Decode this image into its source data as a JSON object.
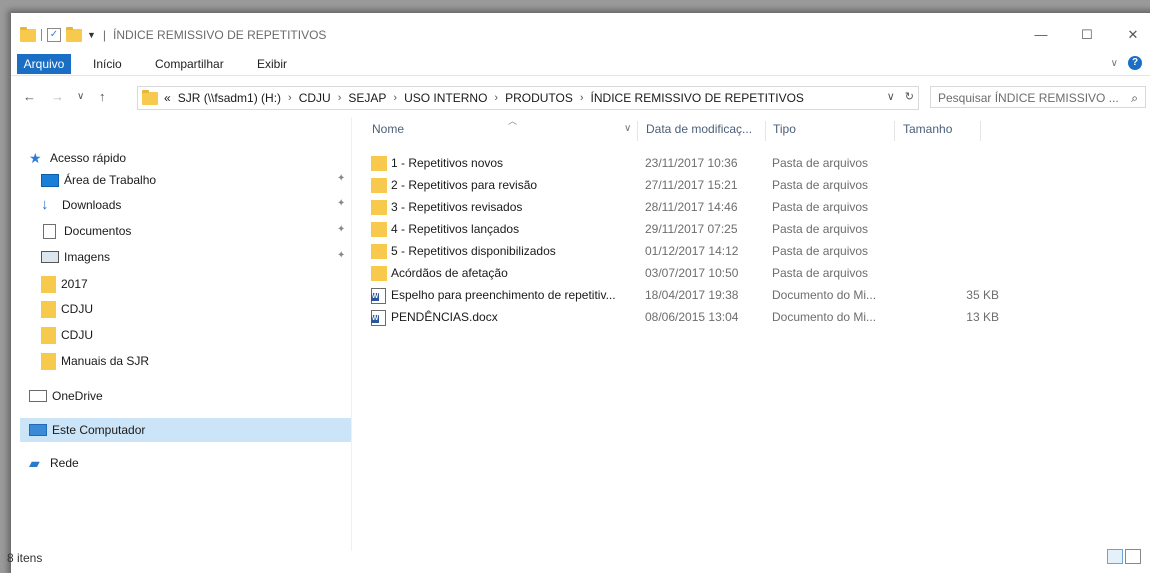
{
  "window": {
    "title": "ÍNDICE REMISSIVO DE REPETITIVOS",
    "title_sep": "|"
  },
  "window_controls": {
    "minimize": "—",
    "maximize": "☐",
    "close": "✕"
  },
  "ribbon": {
    "tabs": [
      "Arquivo",
      "Início",
      "Compartilhar",
      "Exibir"
    ],
    "expand": "∨",
    "help": "?"
  },
  "address": {
    "back": "←",
    "forward": "→",
    "recent": "∨",
    "up": "↑",
    "prefix": "«",
    "crumbs": [
      "SJR (\\\\fsadm1) (H:)",
      "CDJU",
      "SEJAP",
      "USO INTERNO",
      "PRODUTOS",
      "ÍNDICE REMISSIVO DE REPETITIVOS"
    ],
    "sep": "›",
    "dropdown": "∨",
    "refresh": "↻"
  },
  "search": {
    "placeholder": "Pesquisar ÍNDICE REMISSIVO ...",
    "icon": "⌕"
  },
  "nav": {
    "quick_access": "Acesso rápido",
    "pinned": [
      "Área de Trabalho",
      "Downloads",
      "Documentos",
      "Imagens"
    ],
    "folders": [
      "2017",
      "CDJU",
      "CDJU",
      "Manuais da SJR"
    ],
    "onedrive": "OneDrive",
    "this_pc": "Este Computador",
    "network": "Rede",
    "pin_glyph": "✦"
  },
  "columns": {
    "name": "Nome",
    "date": "Data de modificaç...",
    "type": "Tipo",
    "size": "Tamanho",
    "sort_glyph": "︿",
    "dd_glyph": "∨"
  },
  "files": [
    {
      "name": "1 - Repetitivos novos",
      "date": "23/11/2017 10:36",
      "type": "Pasta de arquivos",
      "size": "",
      "icon": "folder"
    },
    {
      "name": "2 - Repetitivos para revisão",
      "date": "27/11/2017 15:21",
      "type": "Pasta de arquivos",
      "size": "",
      "icon": "folder"
    },
    {
      "name": "3 - Repetitivos revisados",
      "date": "28/11/2017 14:46",
      "type": "Pasta de arquivos",
      "size": "",
      "icon": "folder"
    },
    {
      "name": "4 - Repetitivos lançados",
      "date": "29/11/2017 07:25",
      "type": "Pasta de arquivos",
      "size": "",
      "icon": "folder"
    },
    {
      "name": "5 - Repetitivos disponibilizados",
      "date": "01/12/2017 14:12",
      "type": "Pasta de arquivos",
      "size": "",
      "icon": "folder"
    },
    {
      "name": "Acórdãos de afetação",
      "date": "03/07/2017 10:50",
      "type": "Pasta de arquivos",
      "size": "",
      "icon": "folder"
    },
    {
      "name": "Espelho para preenchimento de repetitiv...",
      "date": "18/04/2017 19:38",
      "type": "Documento do Mi...",
      "size": "35 KB",
      "icon": "word"
    },
    {
      "name": "PENDÊNCIAS.docx",
      "date": "08/06/2015 13:04",
      "type": "Documento do Mi...",
      "size": "13 KB",
      "icon": "word"
    }
  ],
  "status": {
    "count": "8 itens"
  }
}
